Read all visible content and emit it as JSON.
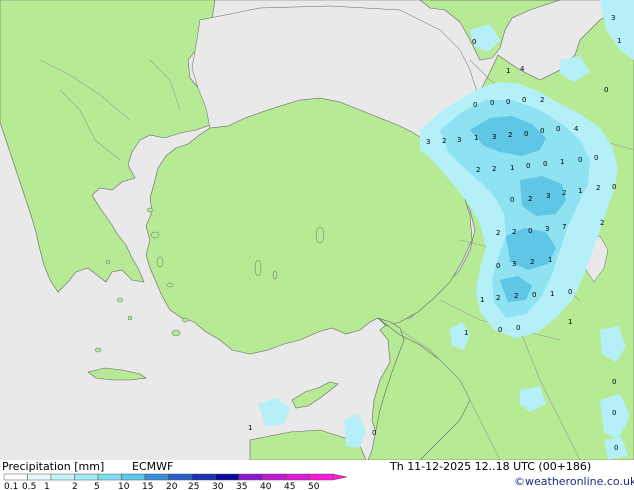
{
  "map": {
    "colors": {
      "sea": "#e9e9e9",
      "land": "#b7ea95",
      "border": "#999999",
      "coast": "#666666",
      "precip_light": "#b5f0f8",
      "precip_mid": "#8ee2f2",
      "precip_dark": "#5fc6e6"
    },
    "precip_values": [
      "0",
      "1",
      "4",
      "3",
      "1",
      "0",
      "0",
      "0",
      "0",
      "0",
      "2",
      "3",
      "2",
      "3",
      "1",
      "3",
      "2",
      "0",
      "0",
      "0",
      "4",
      "2",
      "2",
      "1",
      "0",
      "0",
      "1",
      "0",
      "0",
      "0",
      "2",
      "3",
      "2",
      "1",
      "2",
      "0",
      "2",
      "2",
      "0",
      "3",
      "7",
      "2",
      "0",
      "3",
      "2",
      "1",
      "1",
      "2",
      "2",
      "0",
      "1",
      "0",
      "1",
      "0",
      "0",
      "1",
      "1",
      "0",
      "0",
      "0",
      "0",
      "0"
    ]
  },
  "legend": {
    "title": "Precipitation [mm]",
    "model": "ECMWF",
    "ticks": [
      "0.1",
      "0.5",
      "1",
      "2",
      "5",
      "10",
      "15",
      "20",
      "25",
      "30",
      "35",
      "40",
      "45",
      "50"
    ],
    "colors": [
      "#ffffff",
      "#e8fbfd",
      "#c6f3fa",
      "#a3ebf6",
      "#7fdcf0",
      "#5cc9e8",
      "#3b8fd6",
      "#2b5fc4",
      "#1a30b0",
      "#0a0a9a",
      "#8a1ad0",
      "#c01ad6",
      "#e01ad8",
      "#ff1ad6"
    ]
  },
  "footer": {
    "valid_time": "Th 11-12-2025 12..18 UTC (00+186)",
    "credit": "©weatheronline.co.uk"
  }
}
